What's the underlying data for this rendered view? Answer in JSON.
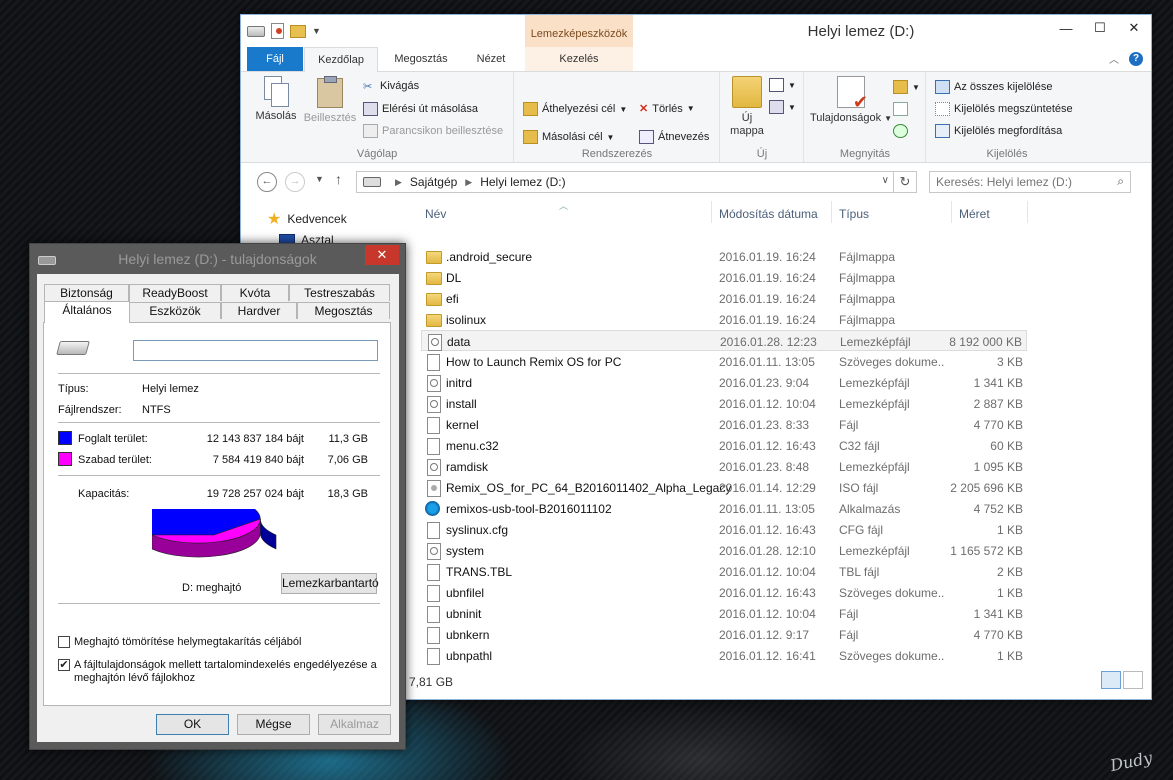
{
  "explorer": {
    "title": "Helyi lemez (D:)",
    "context_tab_title": "Lemezképeszközök",
    "tabs": {
      "file": "Fájl",
      "home": "Kezdőlap",
      "share": "Megosztás",
      "view": "Nézet",
      "manage": "Kezelés"
    },
    "ribbon": {
      "copy": "Másolás",
      "paste": "Beillesztés",
      "cut": "Kivágás",
      "copy_path": "Elérési út másolása",
      "paste_shortcut": "Parancsikon beillesztése",
      "clipboard_group": "Vágólap",
      "move_to": "Áthelyezési cél",
      "copy_to": "Másolási cél",
      "delete": "Törlés",
      "rename": "Átnevezés",
      "organize_group": "Rendszerezés",
      "new_folder": "Új",
      "new_folder_line2": "mappa",
      "new_group": "Új",
      "properties": "Tulajdonságok",
      "open_group": "Megnyitás",
      "select_all": "Az összes kijelölése",
      "select_none": "Kijelölés megszüntetése",
      "invert_selection": "Kijelölés megfordítása",
      "select_group": "Kijelölés"
    },
    "address": {
      "segments": [
        "Sajátgép",
        "Helyi lemez (D:)"
      ]
    },
    "search": {
      "placeholder": "Keresés: Helyi lemez (D:)"
    },
    "nav": {
      "favorites": "Kedvencek",
      "desktop": "Asztal"
    },
    "columns": {
      "name": "Név",
      "date": "Módosítás dátuma",
      "type": "Típus",
      "size": "Méret"
    },
    "files": [
      {
        "name": ".android_secure",
        "date": "2016.01.19. 16:24",
        "type": "Fájlmappa",
        "size": "",
        "icon": "folder-icon"
      },
      {
        "name": "DL",
        "date": "2016.01.19. 16:24",
        "type": "Fájlmappa",
        "size": "",
        "icon": "folder-icon"
      },
      {
        "name": "efi",
        "date": "2016.01.19. 16:24",
        "type": "Fájlmappa",
        "size": "",
        "icon": "folder-icon"
      },
      {
        "name": "isolinux",
        "date": "2016.01.19. 16:24",
        "type": "Fájlmappa",
        "size": "",
        "icon": "folder-icon"
      },
      {
        "name": "data",
        "date": "2016.01.28. 12:23",
        "type": "Lemezképfájl",
        "size": "8 192 000 KB",
        "icon": "disk-image-icon"
      },
      {
        "name": "How to Launch Remix OS for PC",
        "date": "2016.01.11. 13:05",
        "type": "Szöveges doku­me...",
        "size": "3 KB",
        "icon": "text-file-icon"
      },
      {
        "name": "initrd",
        "date": "2016.01.23. 9:04",
        "type": "Lemezképfájl",
        "size": "1 341 KB",
        "icon": "disk-image-icon"
      },
      {
        "name": "install",
        "date": "2016.01.12. 10:04",
        "type": "Lemezképfájl",
        "size": "2 887 KB",
        "icon": "disk-image-icon"
      },
      {
        "name": "kernel",
        "date": "2016.01.23. 8:33",
        "type": "Fájl",
        "size": "4 770 KB",
        "icon": "file-icon"
      },
      {
        "name": "menu.c32",
        "date": "2016.01.12. 16:43",
        "type": "C32 fájl",
        "size": "60 KB",
        "icon": "file-icon"
      },
      {
        "name": "ramdisk",
        "date": "2016.01.23. 8:48",
        "type": "Lemezképfájl",
        "size": "1 095 KB",
        "icon": "disk-image-icon"
      },
      {
        "name": "Remix_OS_for_PC_64_B2016011402_Alpha_Legacy",
        "date": "2016.01.14. 12:29",
        "type": "ISO fájl",
        "size": "2 205 696 KB",
        "icon": "iso-file-icon"
      },
      {
        "name": "remixos-usb-tool-B2016011102",
        "date": "2016.01.11. 13:05",
        "type": "Alkalmazás",
        "size": "4 752 KB",
        "icon": "app-icon"
      },
      {
        "name": "syslinux.cfg",
        "date": "2016.01.12. 16:43",
        "type": "CFG fájl",
        "size": "1 KB",
        "icon": "file-icon"
      },
      {
        "name": "system",
        "date": "2016.01.28. 12:10",
        "type": "Lemezképfájl",
        "size": "1 165 572 KB",
        "icon": "disk-image-icon"
      },
      {
        "name": "TRANS.TBL",
        "date": "2016.01.12. 10:04",
        "type": "TBL fájl",
        "size": "2 KB",
        "icon": "file-icon"
      },
      {
        "name": "ubnfilel",
        "date": "2016.01.12. 16:43",
        "type": "Szöveges dokume...",
        "size": "1 KB",
        "icon": "text-file-icon"
      },
      {
        "name": "ubninit",
        "date": "2016.01.12. 10:04",
        "type": "Fájl",
        "size": "1 341 KB",
        "icon": "file-icon"
      },
      {
        "name": "ubnkern",
        "date": "2016.01.12. 9:17",
        "type": "Fájl",
        "size": "4 770 KB",
        "icon": "file-icon"
      },
      {
        "name": "ubnpathl",
        "date": "2016.01.12. 16:41",
        "type": "Szöveges dokume...",
        "size": "1 KB",
        "icon": "text-file-icon"
      }
    ],
    "selected_row": "data",
    "status": "7,81 GB"
  },
  "properties": {
    "title": "Helyi lemez (D:) - tulajdonságok",
    "tabs_top": [
      "Biztonság",
      "ReadyBoost",
      "Kvóta",
      "Testreszabás"
    ],
    "tabs_bottom": [
      "Általános",
      "Eszközök",
      "Hardver",
      "Megosztás"
    ],
    "active_tab": "Általános",
    "label_value": "",
    "type_label": "Típus:",
    "type_value": "Helyi lemez",
    "fs_label": "Fájlrendszer:",
    "fs_value": "NTFS",
    "used_label": "Foglalt terület:",
    "used_bytes": "12 143 837 184 bájt",
    "used_gb": "11,3 GB",
    "free_label": "Szabad terület:",
    "free_bytes": "7 584 419 840 bájt",
    "free_gb": "7,06 GB",
    "capacity_label": "Kapacitás:",
    "capacity_bytes": "19 728 257 024 bájt",
    "capacity_gb": "18,3 GB",
    "drive_label": "D: meghajtó",
    "cleanup_button": "Lemezkarbantartó",
    "compress_label": "Meghajtó tömörítése helymegtakarítás céljából",
    "compress_checked": false,
    "index_label_line1": "A fájltulajdonságok mellett tartalomindexelés engedélyezése a",
    "index_label_line2": "meghajtón lévő fájlokhoz",
    "index_checked": true,
    "ok": "OK",
    "cancel": "Mégse",
    "apply": "Alkalmaz",
    "used_color": "#0000ff",
    "free_color": "#ff00ff",
    "used_fraction": 0.6156
  },
  "desktop": {
    "signature": "Dudy"
  }
}
